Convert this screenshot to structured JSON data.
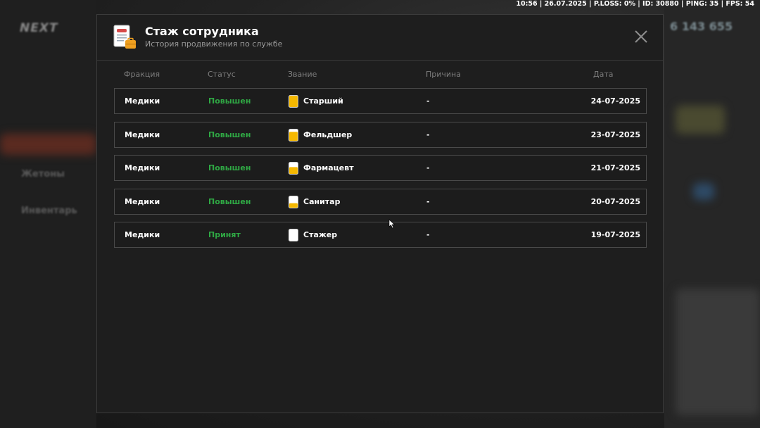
{
  "hud": {
    "text": "10:56 | 26.07.2025 | P.LOSS: 0% | ID: 30880 | PING: 35 | FPS: 54"
  },
  "background": {
    "logo": "NEXT",
    "money": "6 143 655",
    "tokens_label": "Жетоны",
    "inventory_label": "Инвентарь"
  },
  "modal": {
    "title": "Стаж сотрудника",
    "subtitle": "История продвижения по службе",
    "icon": "document-briefcase-icon",
    "close_icon": "close-icon"
  },
  "columns": [
    "Фракция",
    "Статус",
    "Звание",
    "Причина",
    "Дата"
  ],
  "colors": {
    "status_green": "#2fa844",
    "rank_yellow": "#f5b800",
    "text": "#ffffff"
  },
  "rows": [
    {
      "faction": "Медики",
      "status": "Повышен",
      "rank": "Старший",
      "rank_fill": 1.0,
      "reason": "-",
      "date": "24-07-2025"
    },
    {
      "faction": "Медики",
      "status": "Повышен",
      "rank": "Фельдшер",
      "rank_fill": 0.8,
      "reason": "-",
      "date": "23-07-2025"
    },
    {
      "faction": "Медики",
      "status": "Повышен",
      "rank": "Фармацевт",
      "rank_fill": 0.6,
      "reason": "-",
      "date": "21-07-2025"
    },
    {
      "faction": "Медики",
      "status": "Повышен",
      "rank": "Санитар",
      "rank_fill": 0.4,
      "reason": "-",
      "date": "20-07-2025"
    },
    {
      "faction": "Медики",
      "status": "Принят",
      "rank": "Стажер",
      "rank_fill": 0.0,
      "reason": "-",
      "date": "19-07-2025"
    }
  ]
}
